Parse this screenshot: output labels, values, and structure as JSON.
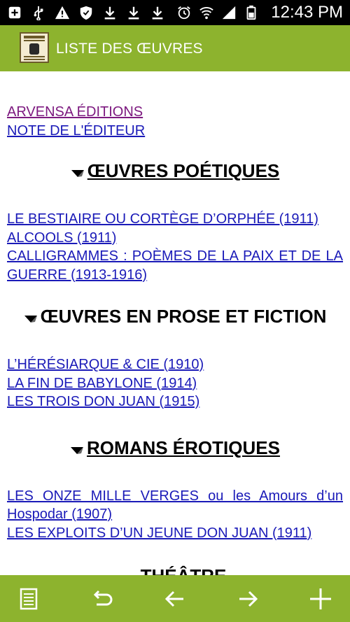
{
  "status_bar": {
    "time": "12:43 PM",
    "icons_left": [
      "add-box-icon",
      "usb-icon",
      "warning-icon",
      "shield-icon",
      "download-icon",
      "download-icon",
      "download-icon"
    ],
    "icons_right": [
      "alarm-icon",
      "wifi-icon",
      "signal-icon",
      "battery-icon"
    ]
  },
  "app_bar": {
    "title": "LISTE DES ŒUVRES",
    "color": "#8db32e"
  },
  "content": {
    "top_links": [
      {
        "label": "ARVENSA ÉDITIONS",
        "visited": true
      },
      {
        "label": "NOTE DE L'ÉDITEUR",
        "visited": false
      }
    ],
    "sections": [
      {
        "heading": "ŒUVRES POÉTIQUES",
        "links": [
          "LE BESTIAIRE OU CORTÈGE D’ORPHÉE (1911)",
          "ALCOOLS (1911)",
          "CALLIGRAMMES : POÈMES DE LA PAIX ET DE LA GUERRE (1913-1916)"
        ]
      },
      {
        "heading": "ŒUVRES EN PROSE ET FICTION",
        "links": [
          "L’HÉRÉSIARQUE & CIE (1910)",
          "LA FIN DE BABYLONE (1914)",
          "LES TROIS DON JUAN (1915)"
        ]
      },
      {
        "heading": "ROMANS ÉROTIQUES",
        "links": [
          "LES ONZE MILLE VERGES ou les Amours d’un Hospodar (1907)",
          "LES EXPLOITS D’UN JEUNE DON JUAN (1911)"
        ]
      },
      {
        "heading": "THÉÂTRE",
        "links": []
      }
    ]
  },
  "bottom_bar": {
    "buttons": [
      "list-icon",
      "undo-icon",
      "arrow-left-icon",
      "arrow-right-icon",
      "plus-icon"
    ]
  }
}
